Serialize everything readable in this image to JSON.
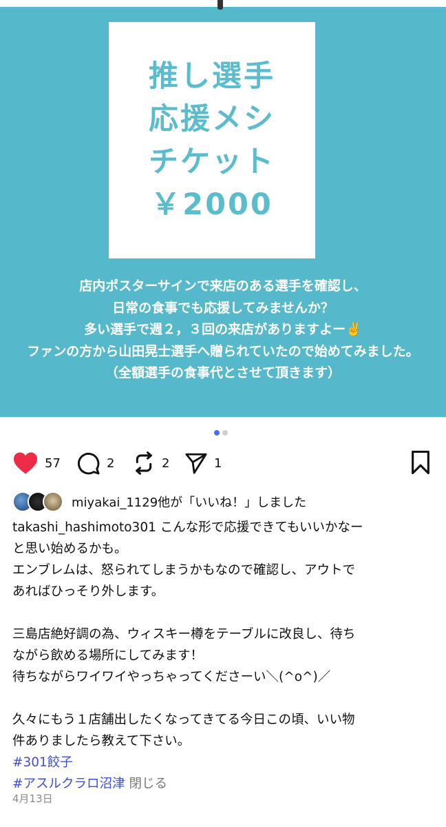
{
  "post_image": {
    "poster_lines": [
      "推し選手",
      "応援メシ",
      "チケット",
      "￥2000"
    ],
    "caption_lines": [
      "店内ポスターサインで来店のある選手を確認し、",
      "日常の食事でも応援してみませんか？",
      "多い選手で週２，３回の来店がありますよー✌️",
      "ファンの方から山田晃士選手へ贈られていたので始めてみました。",
      "（全額選手の食事代とさせて頂きます）"
    ],
    "background_color": "#55b9cb",
    "poster_text_color": "#5bbccd"
  },
  "carousel": {
    "current": 1,
    "total": 2
  },
  "actions": {
    "likes": "57",
    "comments": "2",
    "reposts": "2",
    "shares": "1",
    "like_color": "#ee2c48"
  },
  "liked_by": {
    "text": "miyakai_1129他が「いいね！」しました"
  },
  "caption": {
    "username": "takashi_hashimoto301",
    "line1": " こんな形で応援できてもいいかなー",
    "lines": [
      "と思い始めるかも。",
      "エンブレムは、怒られてしまうかもなので確認し、アウトで",
      "あればひっそり外します。",
      "",
      "三島店絶好調の為、ウィスキー樽をテーブルに改良し、待ち",
      "ながら飲める場所にしてみます！",
      "待ちながらワイワイやっちゃってくださーい＼(^o^)／",
      "",
      "久々にもう１店舗出したくなってきてる今日この頃、いい物",
      "件ありましたら教えて下さい。"
    ],
    "hashtags": [
      "#301餃子",
      "#アスルクラロ沼津"
    ],
    "close_label": "閉じる"
  },
  "date": "4月13日"
}
